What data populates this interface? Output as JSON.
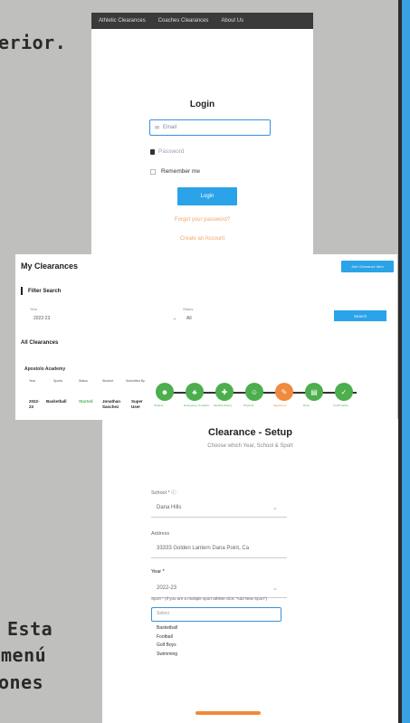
{
  "side_text": {
    "line1": "erior.",
    "line2": "Esta",
    "line3": "menú",
    "line4": "ones"
  },
  "login_panel": {
    "nav_items": [
      "Athletic Clearances",
      "Coaches Clearances",
      "About Us"
    ],
    "title": "Login",
    "email_placeholder": "Email",
    "password_placeholder": "Password",
    "remember_label": "Remember me",
    "login_button": "Login",
    "forgot_link": "Forgot your password?",
    "create_link": "Create an Account"
  },
  "clearances_panel": {
    "title": "My Clearances",
    "add_button": "Add Clearance Item",
    "filter_title": "Filter Search",
    "year_label": "Year",
    "year_value": "2022-23",
    "status_label": "Status",
    "status_value": "All",
    "search_button": "Search",
    "all_title": "All Clearances",
    "org_name": "Apostolo Academy",
    "table_headers": [
      "Year",
      "Sports",
      "Status",
      "Student",
      "Submitted By"
    ],
    "row": {
      "year": "2022-23",
      "sport": "Basketball",
      "status": "Started",
      "student": "Jonathan Sanchez",
      "submitted_by": "Super User"
    },
    "steps": [
      {
        "label": "Student",
        "color": "#4cae4c",
        "icon": "user-icon"
      },
      {
        "label": "Emergency Contacts",
        "color": "#4cae4c",
        "icon": "contacts-icon"
      },
      {
        "label": "Medical History",
        "color": "#4cae4c",
        "icon": "medical-icon"
      },
      {
        "label": "Physical",
        "color": "#4cae4c",
        "icon": "physical-icon"
      },
      {
        "label": "Signatures",
        "color": "#f08a3c",
        "icon": "signature-icon"
      },
      {
        "label": "Docs",
        "color": "#4cae4c",
        "icon": "docs-icon"
      },
      {
        "label": "Confirmation",
        "color": "#4cae4c",
        "icon": "check-icon"
      }
    ]
  },
  "setup_panel": {
    "title": "Clearance - Setup",
    "subtitle": "Choose which Year, School & Sport",
    "school_label": "School * ⓘ",
    "school_value": "Dana Hills",
    "address_label": "Address",
    "address_value": "33333 Golden Lantern Dana Point, Ca",
    "year_label": "Year *",
    "year_value": "2022-23",
    "sport_label": "Sport * (If you are a multiple sport athlete click \"Add New Sport\")",
    "sport_placeholder": "Select",
    "sport_options": [
      "Basketball",
      "Football",
      "Golf Boys",
      "Swimming"
    ]
  }
}
